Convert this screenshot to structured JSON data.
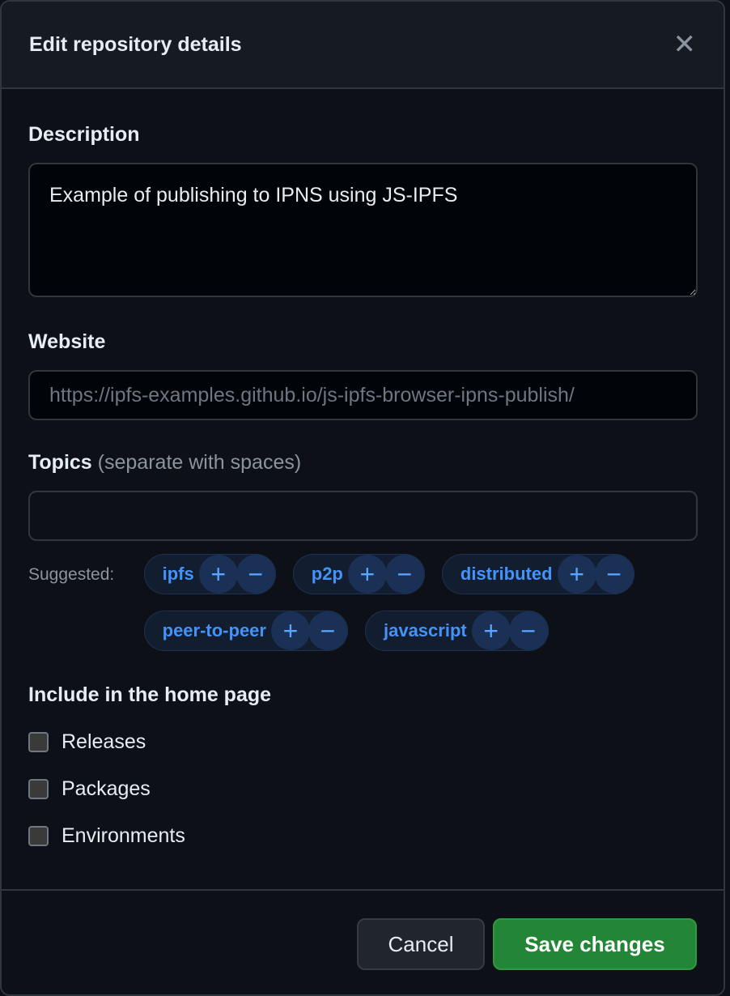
{
  "dialog": {
    "title": "Edit repository details"
  },
  "description": {
    "label": "Description",
    "value": "Example of publishing to IPNS using JS-IPFS"
  },
  "website": {
    "label": "Website",
    "placeholder": "https://ipfs-examples.github.io/js-ipfs-browser-ipns-publish/"
  },
  "topics": {
    "label": "Topics",
    "hint": "(separate with spaces)",
    "value": "",
    "suggested_label": "Suggested:",
    "suggested": [
      {
        "label": "ipfs"
      },
      {
        "label": "p2p"
      },
      {
        "label": "distributed"
      },
      {
        "label": "peer-to-peer"
      },
      {
        "label": "javascript"
      }
    ],
    "add_glyph": "+",
    "remove_glyph": "−"
  },
  "home": {
    "label": "Include in the home page",
    "options": [
      {
        "label": "Releases",
        "checked": false
      },
      {
        "label": "Packages",
        "checked": false
      },
      {
        "label": "Environments",
        "checked": false
      }
    ]
  },
  "footer": {
    "cancel": "Cancel",
    "save": "Save changes"
  },
  "colors": {
    "accent": "#4493f8",
    "save": "#238636",
    "bg": "#0d1117"
  }
}
